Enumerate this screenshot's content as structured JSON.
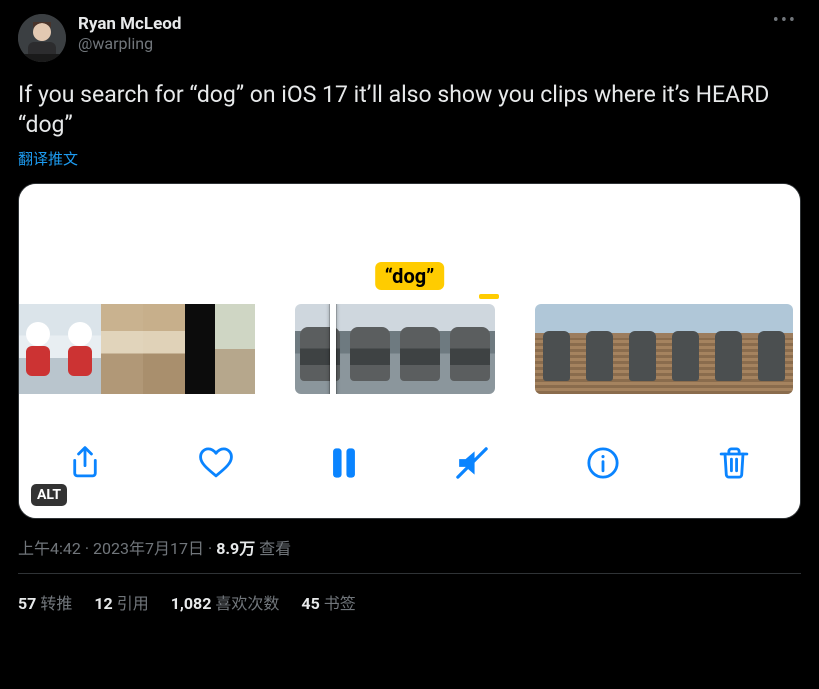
{
  "header": {
    "display_name": "Ryan McLeod",
    "handle": "@warpling"
  },
  "body": {
    "text": "If you search for “dog” on iOS 17 it’ll also show you clips where it’s HEARD “dog”",
    "translate_label": "翻译推文"
  },
  "media": {
    "tag_label": "“dog”",
    "alt_label": "ALT"
  },
  "meta": {
    "time": "上午4:42",
    "date": "2023年7月17日",
    "views_number": "8.9万",
    "views_label": "查看"
  },
  "stats": {
    "retweets": {
      "count": "57",
      "label": "转推"
    },
    "quotes": {
      "count": "12",
      "label": "引用"
    },
    "likes": {
      "count": "1,082",
      "label": "喜欢次数"
    },
    "bookmarks": {
      "count": "45",
      "label": "书签"
    }
  }
}
